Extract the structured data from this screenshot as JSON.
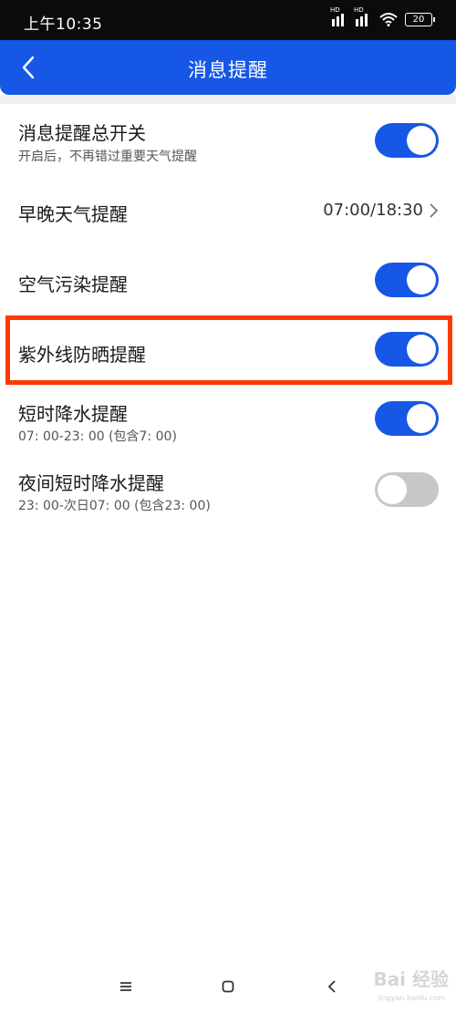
{
  "status_bar": {
    "time": "上午10:35",
    "signal1_label": "HD",
    "signal2_label": "HD",
    "battery": "20"
  },
  "header": {
    "title": "消息提醒",
    "background_color": "#1657e6"
  },
  "settings": [
    {
      "label": "消息提醒总开关",
      "sub": "开启后，不再错过重要天气提醒",
      "control": "toggle",
      "state": "on"
    },
    {
      "label": "早晚天气提醒",
      "value": "07:00/18:30",
      "control": "chevron"
    },
    {
      "label": "空气污染提醒",
      "control": "toggle",
      "state": "on"
    },
    {
      "label": "紫外线防晒提醒",
      "control": "toggle",
      "state": "on",
      "highlighted": true
    },
    {
      "label": "短时降水提醒",
      "sub": "07: 00-23: 00 (包含7: 00)",
      "control": "toggle",
      "state": "on"
    },
    {
      "label": "夜间短时降水提醒",
      "sub": "23: 00-次日07: 00 (包含23: 00)",
      "control": "toggle",
      "state": "off"
    }
  ],
  "colors": {
    "toggle_on": "#1657e6",
    "toggle_off": "#c7c7c7",
    "highlight_border": "#ff3a00"
  },
  "icons": {
    "back": "chevron-left-icon",
    "menu": "menu-icon",
    "home": "home-icon",
    "nav_back": "back-triangle-icon"
  },
  "watermark": {
    "text": "Bai 经验",
    "url": "jingyan.baidu.com"
  }
}
